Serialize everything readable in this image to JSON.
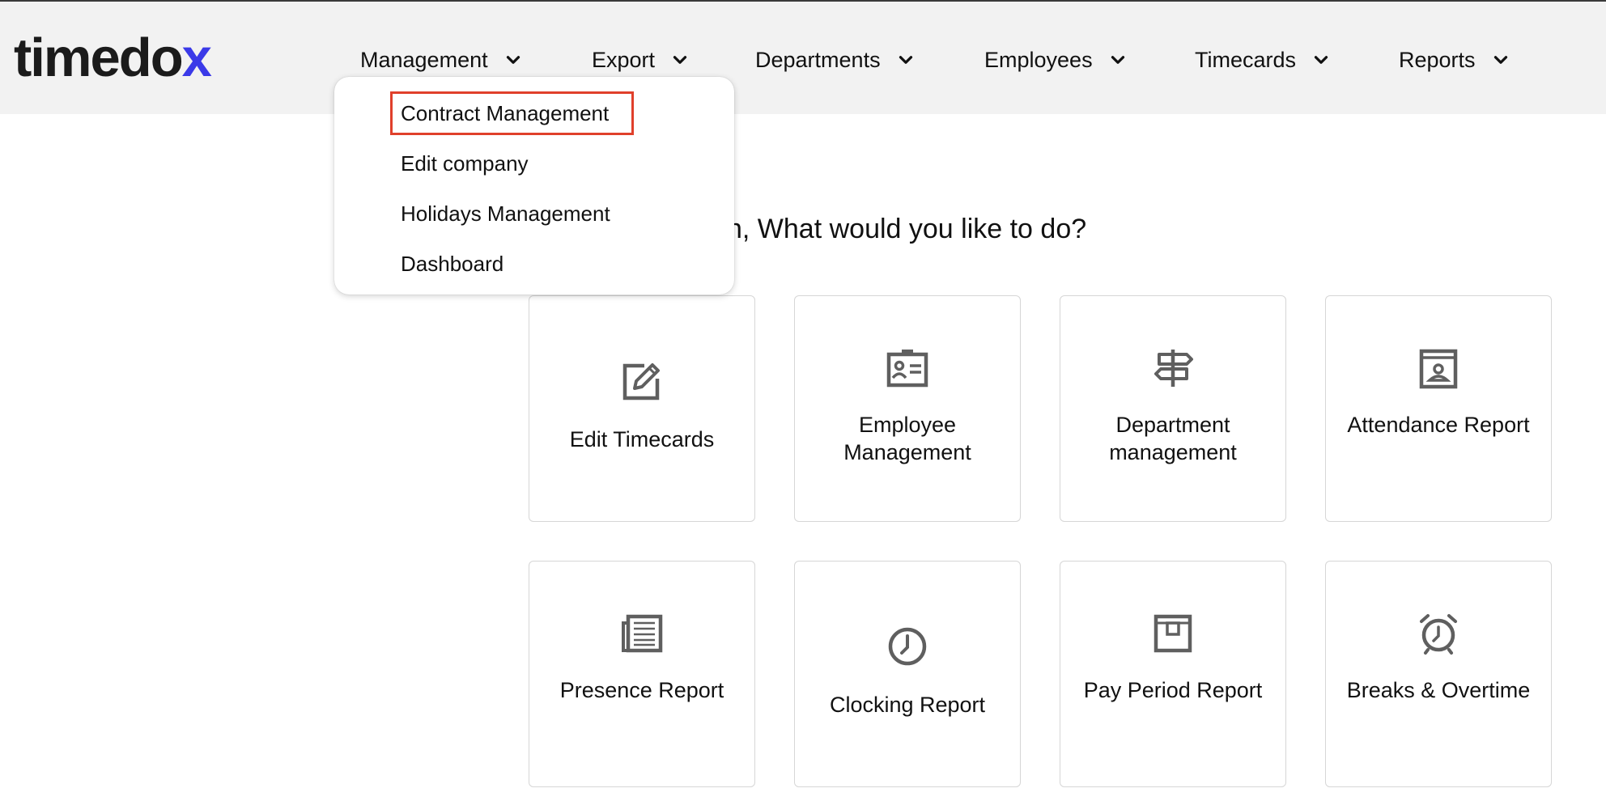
{
  "app": {
    "logo_main": "timedo",
    "logo_accent": "x"
  },
  "nav": {
    "items": [
      {
        "label": "Management"
      },
      {
        "label": "Export"
      },
      {
        "label": "Departments"
      },
      {
        "label": "Employees"
      },
      {
        "label": "Timecards"
      },
      {
        "label": "Reports"
      }
    ]
  },
  "dropdown": {
    "items": [
      {
        "label": "Contract Management",
        "highlighted": true
      },
      {
        "label": "Edit company"
      },
      {
        "label": "Holidays Management"
      },
      {
        "label": "Dashboard"
      }
    ],
    "highlight_color": "#e0402b"
  },
  "greeting": "n, What would you like to do?",
  "cards": [
    {
      "label": "Edit Timecards",
      "icon": "edit-icon"
    },
    {
      "label": "Employee Management",
      "icon": "id-badge-icon"
    },
    {
      "label": "Department management",
      "icon": "signpost-icon"
    },
    {
      "label": "Attendance Report",
      "icon": "contact-book-icon"
    },
    {
      "label": "Presence Report",
      "icon": "newspaper-icon"
    },
    {
      "label": "Clocking Report",
      "icon": "clock-icon"
    },
    {
      "label": "Pay Period Report",
      "icon": "calendar-box-icon"
    },
    {
      "label": "Breaks & Overtime",
      "icon": "alarm-clock-icon"
    }
  ],
  "colors": {
    "brand_accent": "#3b3ae8",
    "header_bg": "#f2f2f2",
    "icon_gray": "#5f5f5f"
  }
}
